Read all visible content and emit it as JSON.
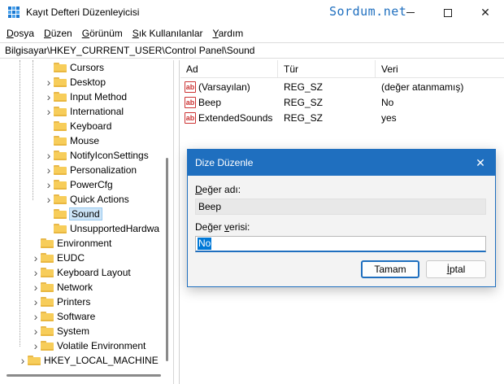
{
  "window": {
    "title": "Kayıt Defteri Düzenleyicisi",
    "watermark": "Sordum.net",
    "minimize_icon": "minimize-icon",
    "maximize_icon": "maximize-icon",
    "close_icon": "close-icon"
  },
  "menu": [
    {
      "label": "Dosya",
      "u": "D",
      "rest": "osya"
    },
    {
      "label": "Düzen",
      "u": "D",
      "rest": "üzen"
    },
    {
      "label": "Görünüm",
      "u": "G",
      "rest": "örünüm"
    },
    {
      "label": "Sık Kullanılanlar",
      "u": "S",
      "rest": "ık Kullanılanlar"
    },
    {
      "label": "Yardım",
      "u": "Y",
      "rest": "ardım"
    }
  ],
  "address": "Bilgisayar\\HKEY_CURRENT_USER\\Control Panel\\Sound",
  "tree": {
    "items": [
      {
        "label": "Cursors",
        "chevron": false,
        "level": 2
      },
      {
        "label": "Desktop",
        "chevron": true,
        "level": 2
      },
      {
        "label": "Input Method",
        "chevron": true,
        "level": 2
      },
      {
        "label": "International",
        "chevron": true,
        "level": 2
      },
      {
        "label": "Keyboard",
        "chevron": false,
        "level": 2
      },
      {
        "label": "Mouse",
        "chevron": false,
        "level": 2
      },
      {
        "label": "NotifyIconSettings",
        "chevron": true,
        "level": 2
      },
      {
        "label": "Personalization",
        "chevron": true,
        "level": 2
      },
      {
        "label": "PowerCfg",
        "chevron": true,
        "level": 2
      },
      {
        "label": "Quick Actions",
        "chevron": true,
        "level": 2
      },
      {
        "label": "Sound",
        "chevron": false,
        "level": 2,
        "selected": true
      },
      {
        "label": "UnsupportedHardwa",
        "chevron": false,
        "level": 2
      },
      {
        "label": "Environment",
        "chevron": false,
        "level": 1
      },
      {
        "label": "EUDC",
        "chevron": true,
        "level": 1
      },
      {
        "label": "Keyboard Layout",
        "chevron": true,
        "level": 1
      },
      {
        "label": "Network",
        "chevron": true,
        "level": 1
      },
      {
        "label": "Printers",
        "chevron": true,
        "level": 1
      },
      {
        "label": "Software",
        "chevron": true,
        "level": 1
      },
      {
        "label": "System",
        "chevron": true,
        "level": 1
      },
      {
        "label": "Volatile Environment",
        "chevron": true,
        "level": 1
      },
      {
        "label": "HKEY_LOCAL_MACHINE",
        "chevron": true,
        "level": 0
      }
    ]
  },
  "list": {
    "headers": {
      "name": "Ad",
      "type": "Tür",
      "data": "Veri"
    },
    "rows": [
      {
        "name": "(Varsayılan)",
        "type": "REG_SZ",
        "data": "(değer atanmamış)",
        "icon": "string-value-icon"
      },
      {
        "name": "Beep",
        "type": "REG_SZ",
        "data": "No",
        "icon": "string-value-icon"
      },
      {
        "name": "ExtendedSounds",
        "type": "REG_SZ",
        "data": "yes",
        "icon": "string-value-icon"
      }
    ],
    "icon_glyph": "ab"
  },
  "dialog": {
    "title": "Dize Düzenle",
    "name_label_u": "D",
    "name_label_rest": "eğer adı:",
    "name_value": "Beep",
    "data_label_first": "Değer ",
    "data_label_u": "v",
    "data_label_rest": "erisi:",
    "data_value": "No",
    "ok_label": "Tamam",
    "cancel_label_u": "İ",
    "cancel_label_rest": "ptal"
  },
  "colors": {
    "accent": "#1f6fbf",
    "selection": "#cce4f7",
    "folder": "#f7cd5a",
    "value_icon": "#cc3333"
  }
}
